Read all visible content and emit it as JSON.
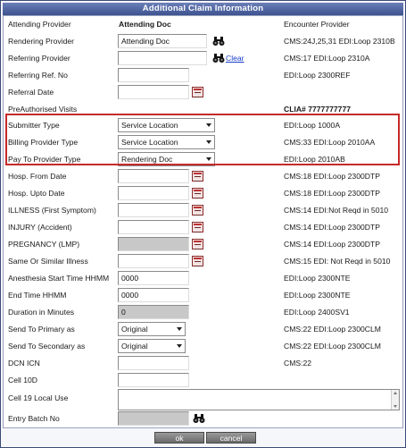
{
  "title": "Additional Claim Information",
  "rows": {
    "attending": {
      "label": "Attending Provider",
      "value": "Attending Doc",
      "info": "Encounter Provider"
    },
    "rendering": {
      "label": "Rendering Provider",
      "value": "Attending Doc",
      "info": "CMS:24J,25,31 EDI:Loop 2310B"
    },
    "referring": {
      "label": "Referring Provider",
      "value": "",
      "link": "Clear",
      "info": "CMS:17 EDI:Loop 2310A"
    },
    "referring_ref": {
      "label": "Referring Ref. No",
      "value": "",
      "info": "EDI:Loop 2300REF"
    },
    "referral_date": {
      "label": "Referral Date",
      "value": ""
    },
    "preauth": {
      "label": "PreAuthorised Visits",
      "info": "CLIA# 7777777777"
    },
    "submitter_type": {
      "label": "Submitter Type",
      "selected": "Service Location",
      "info": "EDI:Loop 1000A"
    },
    "billing_type": {
      "label": "Billing Provider Type",
      "selected": "Service Location",
      "info": "CMS:33 EDI:Loop 2010AA"
    },
    "payto_type": {
      "label": "Pay To Provider Type",
      "selected": "Rendering Doc",
      "info": "EDI:Loop 2010AB"
    },
    "hosp_from": {
      "label": "Hosp. From Date",
      "value": "",
      "info": "CMS:18 EDI:Loop 2300DTP"
    },
    "hosp_upto": {
      "label": "Hosp. Upto Date",
      "value": "",
      "info": "CMS:18 EDI:Loop 2300DTP"
    },
    "illness": {
      "label": "ILLNESS (First Symptom)",
      "value": "",
      "info": "CMS:14 EDI:Not Reqd in 5010"
    },
    "injury": {
      "label": "INJURY (Accident)",
      "value": "",
      "info": "CMS:14 EDI:Loop 2300DTP"
    },
    "pregnancy": {
      "label": "PREGNANCY (LMP)",
      "value": "",
      "info": "CMS:14 EDI:Loop 2300DTP"
    },
    "same_illness": {
      "label": "Same Or Similar Illness",
      "value": "",
      "info": "CMS:15 EDI: Not Reqd in 5010"
    },
    "anesthesia_start": {
      "label": "Anesthesia Start Time HHMM",
      "value": "0000",
      "info": "EDI:Loop 2300NTE"
    },
    "end_time": {
      "label": "End Time HHMM",
      "value": "0000",
      "info": "EDI:Loop 2300NTE"
    },
    "duration": {
      "label": "Duration in Minutes",
      "value": "0",
      "info": "EDI:Loop 2400SV1"
    },
    "send_primary": {
      "label": "Send To Primary as",
      "selected": "Original",
      "info": "CMS:22 EDI:Loop 2300CLM"
    },
    "send_secondary": {
      "label": "Send To Secondary as",
      "selected": "Original",
      "info": "CMS:22 EDI:Loop 2300CLM"
    },
    "dcn_icn": {
      "label": "DCN ICN",
      "value": "",
      "info": "CMS:22"
    },
    "cell_10d": {
      "label": "Cell 10D",
      "value": ""
    },
    "cell_19": {
      "label": "Cell 19 Local Use",
      "value": ""
    },
    "entry_batch": {
      "label": "Entry Batch No",
      "value": ""
    }
  },
  "buttons": {
    "ok": "ok",
    "cancel": "cancel"
  },
  "icons": {
    "calendar": "calendar-icon",
    "search": "binoculars-icon"
  },
  "colors": {
    "title_bar": "#3d528f",
    "highlight": "#c62a2a",
    "link": "#1a3fc9"
  }
}
